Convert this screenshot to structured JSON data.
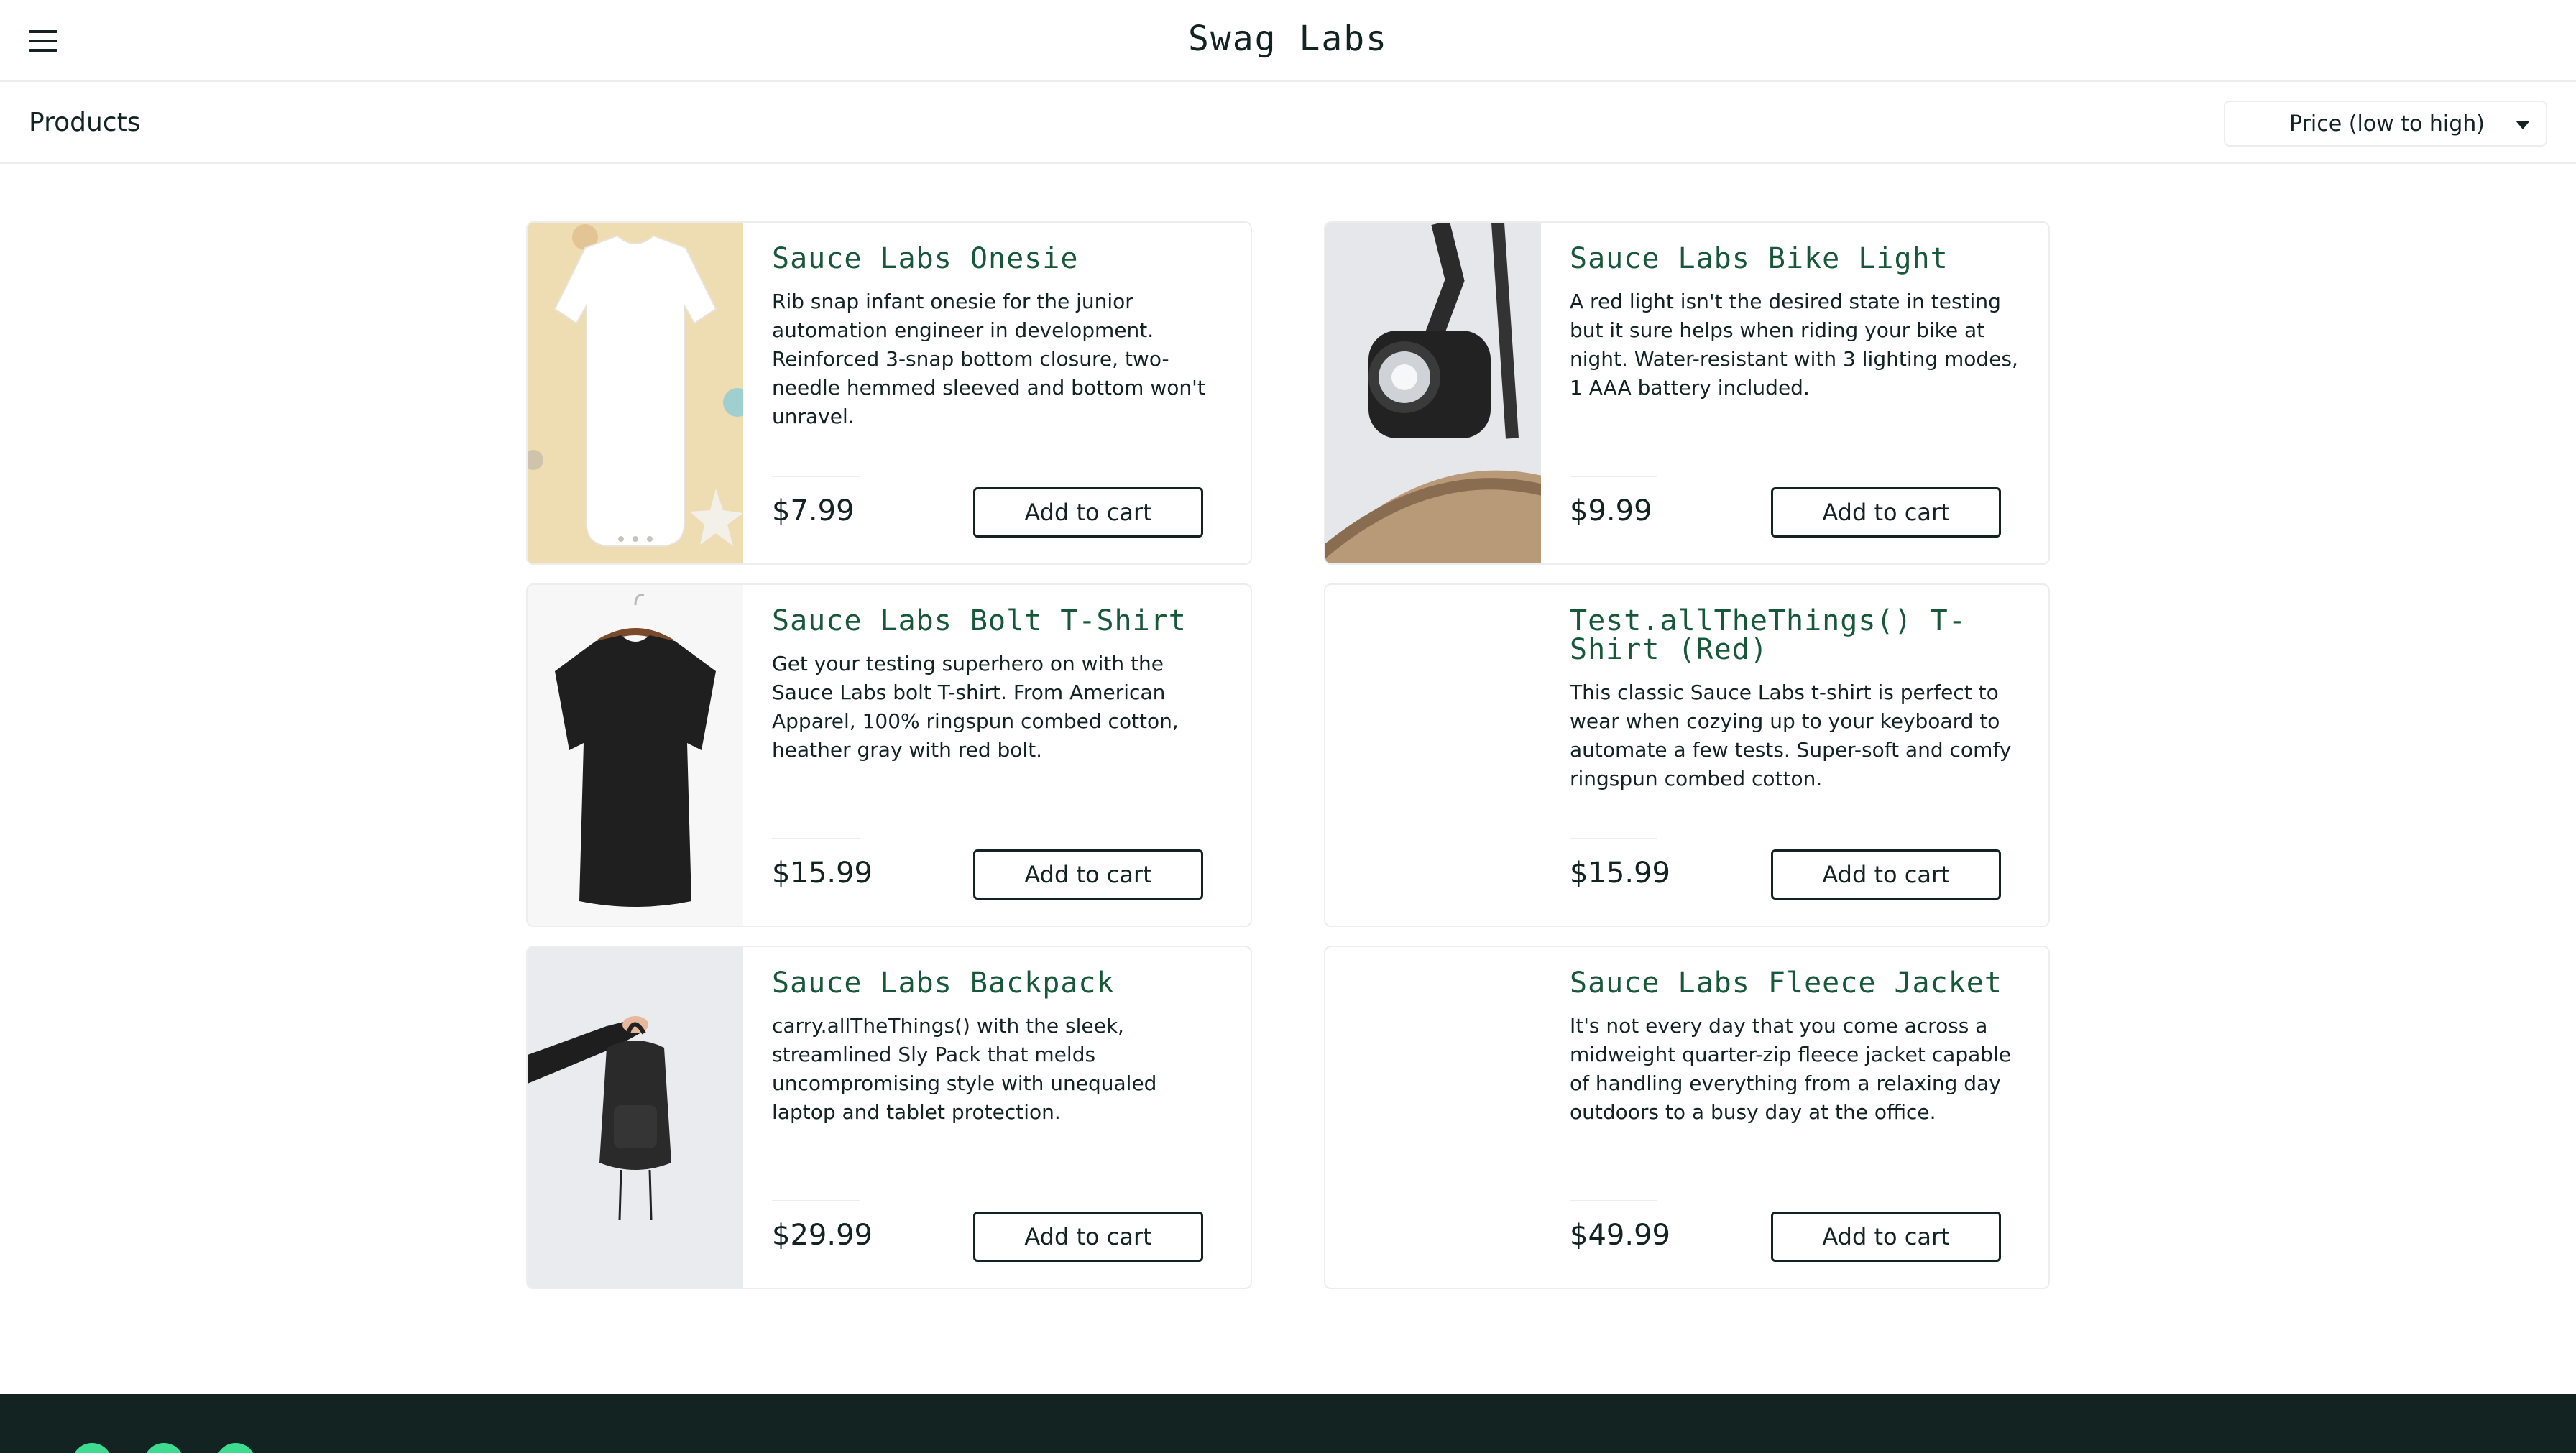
{
  "header": {
    "title": "Swag Labs"
  },
  "sub_header": {
    "title": "Products",
    "sort": {
      "selected": "Price (low to high)"
    }
  },
  "products": [
    {
      "name": "Sauce Labs Onesie",
      "description": "Rib snap infant onesie for the junior automation engineer in development. Reinforced 3-snap bottom closure, two-needle hemmed sleeved and bottom won't unravel.",
      "price": "$7.99",
      "button": "Add to cart"
    },
    {
      "name": "Sauce Labs Bike Light",
      "description": "A red light isn't the desired state in testing but it sure helps when riding your bike at night. Water-resistant with 3 lighting modes, 1 AAA battery included.",
      "price": "$9.99",
      "button": "Add to cart"
    },
    {
      "name": "Sauce Labs Bolt T-Shirt",
      "description": "Get your testing superhero on with the Sauce Labs bolt T-shirt. From American Apparel, 100% ringspun combed cotton, heather gray with red bolt.",
      "price": "$15.99",
      "button": "Add to cart"
    },
    {
      "name": "Test.allTheThings() T-Shirt (Red)",
      "description": "This classic Sauce Labs t-shirt is perfect to wear when cozying up to your keyboard to automate a few tests. Super-soft and comfy ringspun combed cotton.",
      "price": "$15.99",
      "button": "Add to cart"
    },
    {
      "name": "Sauce Labs Backpack",
      "description": "carry.allTheThings() with the sleek, streamlined Sly Pack that melds uncompromising style with unequaled laptop and tablet protection.",
      "price": "$29.99",
      "button": "Add to cart"
    },
    {
      "name": "Sauce Labs Fleece Jacket",
      "description": "It's not every day that you come across a midweight quarter-zip fleece jacket capable of handling everything from a relaxing day outdoors to a busy day at the office.",
      "price": "$49.99",
      "button": "Add to cart"
    }
  ],
  "colors": {
    "brand_text": "#132322",
    "product_name": "#18583a",
    "footer_bg": "#132322",
    "social_icon": "#3ddc91"
  }
}
